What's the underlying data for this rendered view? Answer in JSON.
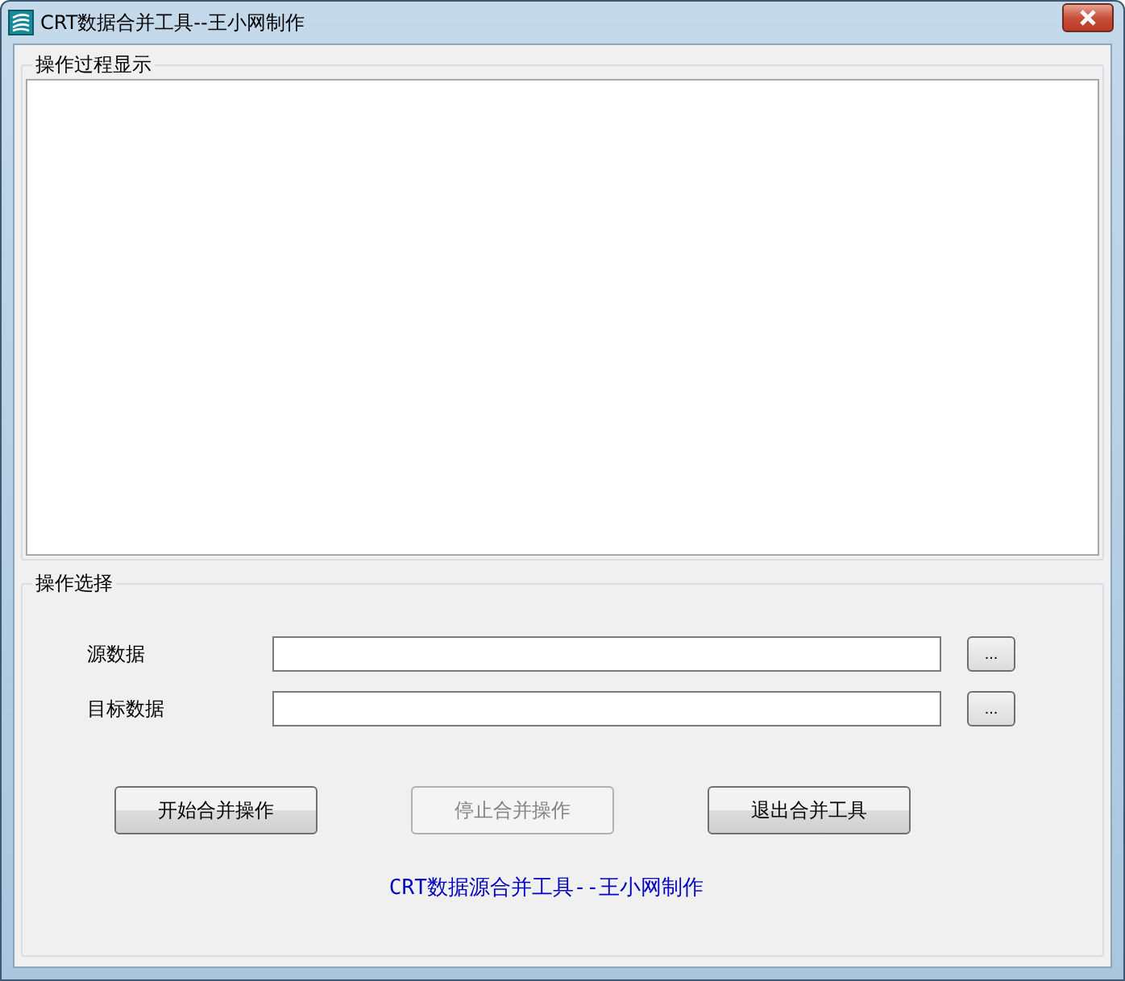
{
  "window": {
    "title": "CRT数据合并工具--王小网制作"
  },
  "log_group": {
    "title": "操作过程显示"
  },
  "options_group": {
    "title": "操作选择",
    "fields": [
      {
        "label": "源数据",
        "browse": "..."
      },
      {
        "label": "目标数据",
        "browse": "..."
      }
    ],
    "buttons": [
      {
        "label": "开始合并操作",
        "disabled": false
      },
      {
        "label": "停止合并操作",
        "disabled": true
      },
      {
        "label": "退出合并工具",
        "disabled": false
      }
    ],
    "footer": "CRT数据源合并工具--王小网制作"
  }
}
